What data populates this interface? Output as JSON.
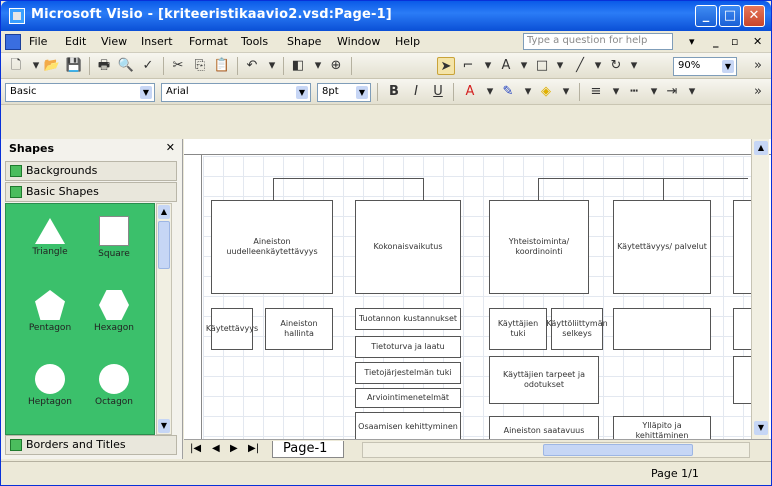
{
  "window": {
    "title": "Microsoft Visio - [kriteeristikaavio2.vsd:Page-1]"
  },
  "menu": {
    "items": [
      "File",
      "Edit",
      "View",
      "Insert",
      "Format",
      "Tools",
      "Shape",
      "Window",
      "Help"
    ],
    "help_placeholder": "Type a question for help"
  },
  "toolbar": {
    "style_value": "Basic",
    "font_value": "Arial",
    "size_value": "8pt",
    "zoom_value": "90%"
  },
  "shapes_pane": {
    "title": "Shapes",
    "stencils": [
      "Backgrounds",
      "Basic Shapes",
      "Borders and Titles"
    ],
    "masters": [
      "Triangle",
      "Square",
      "Pentagon",
      "Hexagon",
      "Heptagon",
      "Octagon"
    ]
  },
  "diagram": {
    "boxes": [
      "Aineiston uudelleenkäytettävyys",
      "Osaamisen kehittyminen",
      "Kokonaisvaikutus",
      "Yhteistoiminta/ koordinointi",
      "Tietojärjestelmän tuki",
      "Käytettävyys",
      "Aineiston hallinta",
      "Tuotannon kustannukset",
      "Käytettävyys/ palvelut",
      "Tietoturva ja laatu",
      "Käyttäjien tuki",
      "Käyttöliittymän selkeys",
      "Käyttäjien tarpeet ja odotukset",
      "Arviointimenetelmät",
      "Aineiston saatavuus",
      "Ylläpito ja kehittäminen"
    ]
  },
  "tabs": {
    "page": "Page-1"
  },
  "status": {
    "page_indicator": "Page 1/1"
  }
}
